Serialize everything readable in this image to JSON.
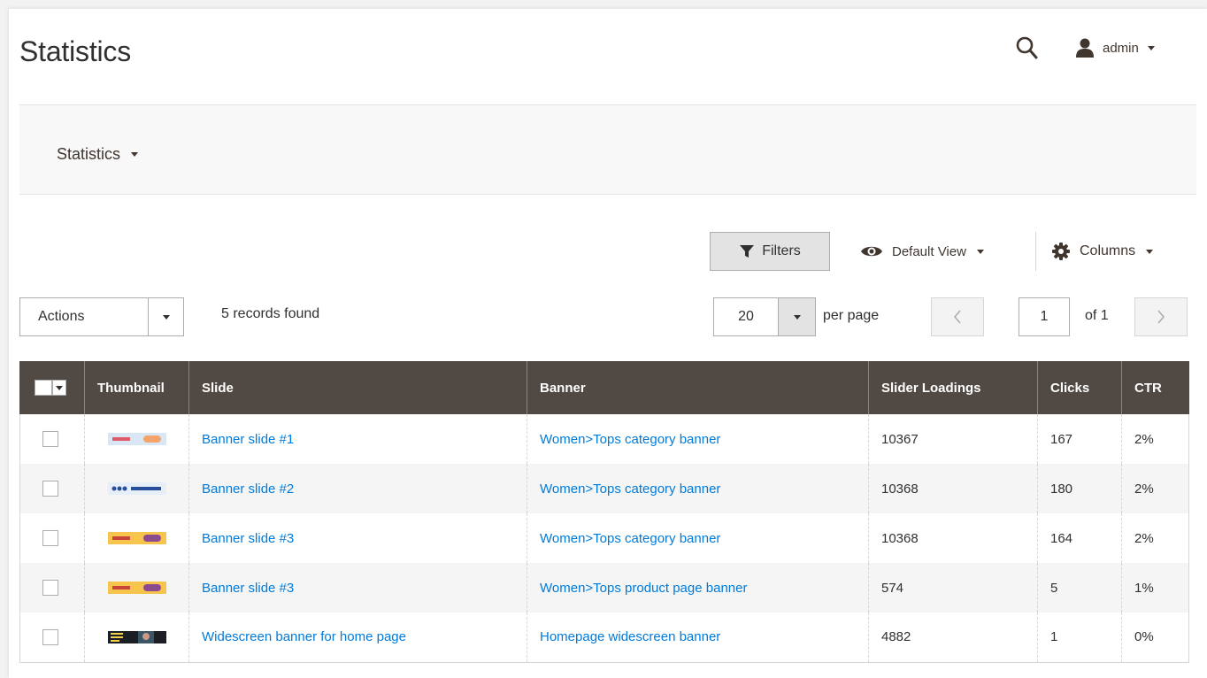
{
  "header": {
    "title": "Statistics",
    "user_label": "admin"
  },
  "subnav": {
    "label": "Statistics"
  },
  "toolbar": {
    "filters_label": "Filters",
    "view_label": "Default View",
    "columns_label": "Columns",
    "actions_label": "Actions",
    "records_found": "5 records found",
    "per_page_value": "20",
    "per_page_label": "per page",
    "current_page": "1",
    "of_pages": "of 1"
  },
  "table": {
    "columns": [
      "Thumbnail",
      "Slide",
      "Banner",
      "Slider Loadings",
      "Clicks",
      "CTR"
    ],
    "rows": [
      {
        "thumb": "banner-thumb-red",
        "slide": "Banner slide #1",
        "banner": "Women>Tops category banner",
        "loadings": "10367",
        "clicks": "167",
        "ctr": "2%"
      },
      {
        "thumb": "banner-thumb-blue",
        "slide": "Banner slide #2",
        "banner": "Women>Tops category banner",
        "loadings": "10368",
        "clicks": "180",
        "ctr": "2%"
      },
      {
        "thumb": "banner-thumb-yellow",
        "slide": "Banner slide #3",
        "banner": "Women>Tops category banner",
        "loadings": "10368",
        "clicks": "164",
        "ctr": "2%"
      },
      {
        "thumb": "banner-thumb-yellow",
        "slide": "Banner slide #3",
        "banner": "Women>Tops product page banner",
        "loadings": "574",
        "clicks": "5",
        "ctr": "1%"
      },
      {
        "thumb": "banner-thumb-dark",
        "slide": "Widescreen banner for home page",
        "banner": "Homepage widescreen banner",
        "loadings": "4882",
        "clicks": "1",
        "ctr": "0%"
      }
    ]
  },
  "colors": {
    "header_bg": "#514943",
    "link": "#007bdb",
    "text": "#303030"
  }
}
